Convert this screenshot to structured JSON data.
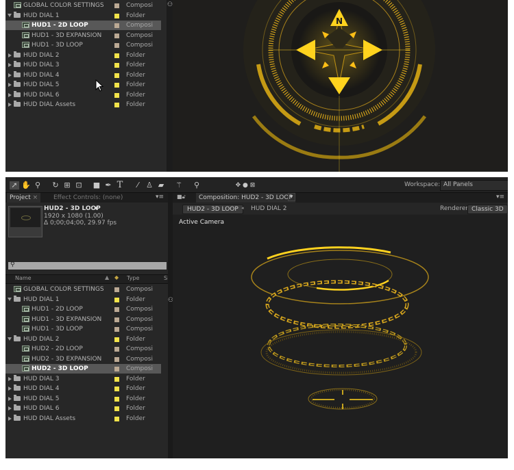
{
  "colors": {
    "folder_label": "#f2e34a",
    "comp_label": "#bba994",
    "hud_yellow": "#ffd21f"
  },
  "top": {
    "rows": [
      {
        "name": "GLOBAL COLOR SETTINGS",
        "type": "Composi",
        "kind": "comp",
        "label": "comp",
        "indent": 0,
        "toggle": "none",
        "selected": false
      },
      {
        "name": "HUD DIAL 1",
        "type": "Folder",
        "kind": "folder",
        "label": "folder",
        "indent": 0,
        "toggle": "open",
        "selected": false
      },
      {
        "name": "HUD1 - 2D LOOP",
        "type": "Composi",
        "kind": "comp",
        "label": "comp",
        "indent": 1,
        "toggle": "none",
        "selected": true
      },
      {
        "name": "HUD1 - 3D EXPANSION",
        "type": "Composi",
        "kind": "comp",
        "label": "comp",
        "indent": 1,
        "toggle": "none",
        "selected": false
      },
      {
        "name": "HUD1 - 3D LOOP",
        "type": "Composi",
        "kind": "comp",
        "label": "comp",
        "indent": 1,
        "toggle": "none",
        "selected": false
      },
      {
        "name": "HUD DIAL 2",
        "type": "Folder",
        "kind": "folder",
        "label": "folder",
        "indent": 0,
        "toggle": "closed",
        "selected": false
      },
      {
        "name": "HUD DIAL 3",
        "type": "Folder",
        "kind": "folder",
        "label": "folder",
        "indent": 0,
        "toggle": "closed",
        "selected": false
      },
      {
        "name": "HUD DIAL 4",
        "type": "Folder",
        "kind": "folder",
        "label": "folder",
        "indent": 0,
        "toggle": "closed",
        "selected": false
      },
      {
        "name": "HUD DIAL 5",
        "type": "Folder",
        "kind": "folder",
        "label": "folder",
        "indent": 0,
        "toggle": "closed",
        "selected": false
      },
      {
        "name": "HUD DIAL 6",
        "type": "Folder",
        "kind": "folder",
        "label": "folder",
        "indent": 0,
        "toggle": "closed",
        "selected": false
      },
      {
        "name": "HUD DIAL Assets",
        "type": "Folder",
        "kind": "folder",
        "label": "folder",
        "indent": 0,
        "toggle": "closed",
        "selected": false
      }
    ],
    "compass_letter": "N"
  },
  "bottom": {
    "workspace_label": "Workspace:",
    "workspace_value": "All Panels",
    "project_tab": "Project",
    "effect_tab": "Effect Controls: (none)",
    "comp_tab": "Composition: HUD2 - 3D LOOP",
    "item_name": "HUD2 - 3D LOOP",
    "item_size": "1920 x 1080 (1.00)",
    "item_duration": "Δ 0;00;04;00, 29.97 fps",
    "search_icon_glyph": "⚲",
    "col_name": "Name",
    "col_type": "Type",
    "col_size": "Siz",
    "breadcrumb": [
      "HUD2 - 3D LOOP",
      "HUD DIAL 2"
    ],
    "renderer_label": "Renderer:",
    "renderer_value": "Classic 3D",
    "active_camera": "Active Camera",
    "rows": [
      {
        "name": "GLOBAL COLOR SETTINGS",
        "type": "Composi",
        "kind": "comp",
        "label": "comp",
        "indent": 0,
        "toggle": "none",
        "selected": false
      },
      {
        "name": "HUD DIAL 1",
        "type": "Folder",
        "kind": "folder",
        "label": "folder",
        "indent": 0,
        "toggle": "open",
        "selected": false
      },
      {
        "name": "HUD1 - 2D LOOP",
        "type": "Composi",
        "kind": "comp",
        "label": "comp",
        "indent": 1,
        "toggle": "none",
        "selected": false
      },
      {
        "name": "HUD1 - 3D EXPANSION",
        "type": "Composi",
        "kind": "comp",
        "label": "comp",
        "indent": 1,
        "toggle": "none",
        "selected": false
      },
      {
        "name": "HUD1 - 3D LOOP",
        "type": "Composi",
        "kind": "comp",
        "label": "comp",
        "indent": 1,
        "toggle": "none",
        "selected": false
      },
      {
        "name": "HUD DIAL 2",
        "type": "Folder",
        "kind": "folder",
        "label": "folder",
        "indent": 0,
        "toggle": "open",
        "selected": false
      },
      {
        "name": "HUD2 - 2D LOOP",
        "type": "Composi",
        "kind": "comp",
        "label": "comp",
        "indent": 1,
        "toggle": "none",
        "selected": false
      },
      {
        "name": "HUD2 - 3D EXPANSION",
        "type": "Composi",
        "kind": "comp",
        "label": "comp",
        "indent": 1,
        "toggle": "none",
        "selected": false
      },
      {
        "name": "HUD2 - 3D LOOP",
        "type": "Composi",
        "kind": "comp",
        "label": "comp",
        "indent": 1,
        "toggle": "none",
        "selected": true
      },
      {
        "name": "HUD DIAL 3",
        "type": "Folder",
        "kind": "folder",
        "label": "folder",
        "indent": 0,
        "toggle": "closed",
        "selected": false
      },
      {
        "name": "HUD DIAL 4",
        "type": "Folder",
        "kind": "folder",
        "label": "folder",
        "indent": 0,
        "toggle": "closed",
        "selected": false
      },
      {
        "name": "HUD DIAL 5",
        "type": "Folder",
        "kind": "folder",
        "label": "folder",
        "indent": 0,
        "toggle": "closed",
        "selected": false
      },
      {
        "name": "HUD DIAL 6",
        "type": "Folder",
        "kind": "folder",
        "label": "folder",
        "indent": 0,
        "toggle": "closed",
        "selected": false
      },
      {
        "name": "HUD DIAL Assets",
        "type": "Folder",
        "kind": "folder",
        "label": "folder",
        "indent": 0,
        "toggle": "closed",
        "selected": false
      }
    ]
  }
}
